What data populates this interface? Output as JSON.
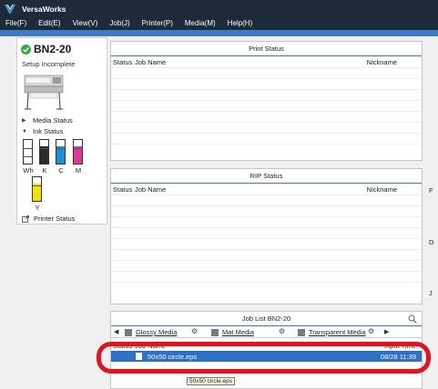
{
  "app": {
    "title": "VersaWorks",
    "logo_icon": "versaworks-logo-icon"
  },
  "menu": [
    "File(F)",
    "Edit(E)",
    "View(V)",
    "Job(J)",
    "Printer(P)",
    "Media(M)",
    "Help(H)"
  ],
  "printer": {
    "name": "BN2-20",
    "status_icon": "check-circle-icon",
    "status_text": "Setup Incomplete",
    "media_status_label": "Media Status",
    "ink_status_label": "Ink Status",
    "printer_status_label": "Printer Status",
    "inks": [
      {
        "label": "Wh",
        "color": "#ffffff",
        "level": 0
      },
      {
        "label": "K",
        "color": "#2a2a2a",
        "level": 0.72
      },
      {
        "label": "C",
        "color": "#1e8fd6",
        "level": 0.72
      },
      {
        "label": "M",
        "color": "#e0379a",
        "level": 0.72
      },
      {
        "label": "Y",
        "color": "#f2e400",
        "level": 0.72
      }
    ]
  },
  "print_status": {
    "title": "Print Status",
    "col_status": "Status",
    "col_job": "Job Name",
    "col_right": "Nickname"
  },
  "rip_status": {
    "title": "RIP Status",
    "col_status": "Status",
    "col_job": "Job Name",
    "col_right": "Nickname"
  },
  "job_list": {
    "title": "Job List BN2-20",
    "tabs": [
      "Glossy Media",
      "Mat Media",
      "Transparent Media"
    ],
    "col_status": "Status",
    "col_job": "Job Name",
    "col_right": "Input Time",
    "rows": [
      {
        "name": "50x50 circle.eps",
        "time": "08/28 11:39"
      }
    ]
  },
  "tooltip": "50x50 circle.eps",
  "right_labels": [
    "F",
    "D",
    "J"
  ],
  "colors": {
    "titlebar": "#1c2a3a",
    "accent": "#3e7cc4",
    "selection": "#2f6fc4",
    "highlight": "#e0141e"
  }
}
